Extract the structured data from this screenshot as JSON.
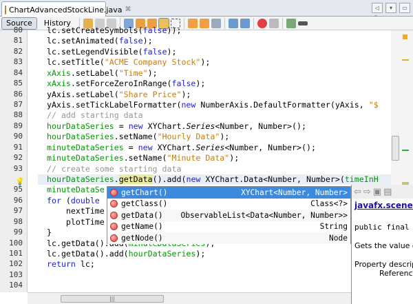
{
  "tab": {
    "title": "ChartAdvancedStockLine.java",
    "close": "⌘"
  },
  "window_buttons": [
    "◁ ▷",
    "▾",
    "▭"
  ],
  "toolbar": {
    "source": "Source",
    "history": "History"
  },
  "gutter": {
    "first_line": 80,
    "lines": [
      "80",
      "81",
      "82",
      "83",
      "84",
      "85",
      "86",
      "87",
      "88",
      "89",
      "90",
      "91",
      "92",
      "93",
      "",
      "95",
      "96",
      "97",
      "98",
      "99",
      "100",
      "101",
      "102",
      "103",
      "104"
    ]
  },
  "code": [
    [
      [
        "",
        "lc.setCreateSymbols("
      ],
      [
        "kw",
        "false"
      ],
      [
        "",
        "));"
      ]
    ],
    [
      [
        "",
        "lc.setAnimated("
      ],
      [
        "kw",
        "false"
      ],
      [
        "",
        ");"
      ]
    ],
    [
      [
        "",
        "lc.setLegendVisible("
      ],
      [
        "kw",
        "false"
      ],
      [
        "",
        ");"
      ]
    ],
    [
      [
        "",
        "lc.setTitle("
      ],
      [
        "str",
        "\"ACME Company Stock\""
      ],
      [
        "",
        ");"
      ]
    ],
    [
      [
        "fld",
        "xAxis"
      ],
      [
        "",
        ".setLabel("
      ],
      [
        "str",
        "\"Time\""
      ],
      [
        "",
        ");"
      ]
    ],
    [
      [
        "fld",
        "xAxis"
      ],
      [
        "",
        ".setForceZeroInRange("
      ],
      [
        "kw",
        "false"
      ],
      [
        "",
        ");"
      ]
    ],
    [
      [
        "",
        "yAxis.setLabel("
      ],
      [
        "str",
        "\"Share Price\""
      ],
      [
        "",
        ");"
      ]
    ],
    [
      [
        "",
        "yAxis.setTickLabelFormatter("
      ],
      [
        "kw",
        "new"
      ],
      [
        "",
        " NumberAxis.DefaultFormatter(yAxis, "
      ],
      [
        "str",
        "\"$"
      ]
    ],
    [
      [
        "cm",
        "// add starting data"
      ]
    ],
    [
      [
        "fld",
        "hourDataSeries"
      ],
      [
        "",
        " = "
      ],
      [
        "kw",
        "new"
      ],
      [
        "",
        " XYChart."
      ],
      [
        "it",
        "Series"
      ],
      [
        "",
        "<Number, Number>();"
      ]
    ],
    [
      [
        "fld",
        "hourDataSeries"
      ],
      [
        "",
        ".setName("
      ],
      [
        "str",
        "\"Hourly Data\""
      ],
      [
        "",
        ");"
      ]
    ],
    [
      [
        "fld",
        "minuteDataSeries"
      ],
      [
        "",
        " = "
      ],
      [
        "kw",
        "new"
      ],
      [
        "",
        " XYChart."
      ],
      [
        "it",
        "Series"
      ],
      [
        "",
        "<Number, Number>();"
      ]
    ],
    [
      [
        "fld",
        "minuteDataSeries"
      ],
      [
        "",
        ".setName("
      ],
      [
        "str",
        "\"Minute Data\""
      ],
      [
        "",
        ");"
      ]
    ],
    [
      [
        "cm",
        "// create some starting data"
      ]
    ],
    [
      [
        "fld",
        "hourDataSeries"
      ],
      [
        "",
        "."
      ],
      [
        "hl",
        "getData"
      ],
      [
        "",
        "().add("
      ],
      [
        "kw",
        "new"
      ],
      [
        "",
        " XYChart.Data<Number, Number>("
      ],
      [
        "fld",
        "timeInH"
      ]
    ],
    [
      [
        "fld",
        "minuteDataSe"
      ]
    ],
    [
      [
        "kw",
        "for"
      ],
      [
        "",
        " ("
      ],
      [
        "kw",
        "double"
      ]
    ],
    [
      [
        "",
        "    nextTime"
      ]
    ],
    [
      [
        "",
        "    plotTime"
      ]
    ],
    [
      [
        "",
        "}"
      ]
    ],
    [
      [
        "",
        "lc.getData().add("
      ],
      [
        "fld",
        "minuteDataSeries"
      ],
      [
        "",
        ");"
      ]
    ],
    [
      [
        "",
        "lc.getData().add("
      ],
      [
        "fld",
        "hourDataSeries"
      ],
      [
        "",
        ");"
      ]
    ],
    [
      [
        "kw",
        "return"
      ],
      [
        "",
        " lc;"
      ]
    ],
    [],
    []
  ],
  "completion": {
    "items": [
      {
        "name": "getChart()",
        "type": "XYChart<Number, Number>",
        "selected": true
      },
      {
        "name": "getClass()",
        "type": "Class<?>"
      },
      {
        "name": "getData()",
        "type": "ObservableList<Data<Number, Number>>"
      },
      {
        "name": "getName()",
        "type": "String"
      },
      {
        "name": "getNode()",
        "type": "Node"
      }
    ]
  },
  "doc": {
    "link": "javafx.scene.chart.XYChart.Series",
    "signature": "public final",
    "desc": "Gets the value of",
    "property": "Property description:",
    "reference": "Reference to the chart"
  },
  "colors": {
    "keyword": "#2020d8",
    "string": "#ce7b00",
    "field": "#009900",
    "comment": "#969696",
    "selection": "#3c8ae0"
  }
}
